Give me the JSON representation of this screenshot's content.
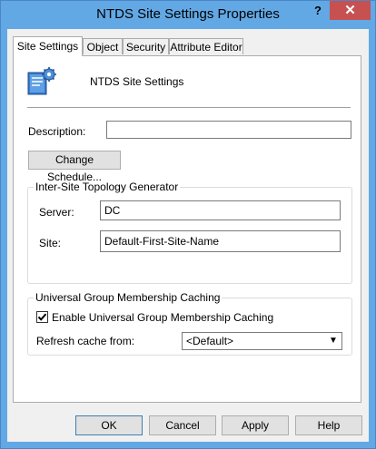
{
  "window": {
    "title": "NTDS Site Settings Properties",
    "help_label": "?",
    "close_label": "✕"
  },
  "tabs": [
    {
      "label": "Site Settings",
      "active": true
    },
    {
      "label": "Object",
      "active": false
    },
    {
      "label": "Security",
      "active": false
    },
    {
      "label": "Attribute Editor",
      "active": false
    }
  ],
  "site_settings": {
    "object_name": "NTDS Site Settings",
    "object_icon": "site-settings-icon",
    "description_label": "Description:",
    "description_value": "",
    "change_schedule_label": "Change Schedule...",
    "istg": {
      "title": "Inter-Site Topology Generator",
      "server_label": "Server:",
      "server_value": "DC",
      "site_label": "Site:",
      "site_value": "Default-First-Site-Name"
    },
    "ugmc": {
      "title": "Universal Group Membership Caching",
      "enable_label": "Enable Universal Group Membership Caching",
      "enable_checked": true,
      "refresh_label": "Refresh cache from:",
      "refresh_value": "<Default>"
    }
  },
  "buttons": {
    "ok": "OK",
    "cancel": "Cancel",
    "apply": "Apply",
    "help": "Help"
  },
  "colors": {
    "titlebar": "#62a8e5",
    "close": "#c75050",
    "panel": "#ffffff",
    "client": "#f0f0f0"
  }
}
